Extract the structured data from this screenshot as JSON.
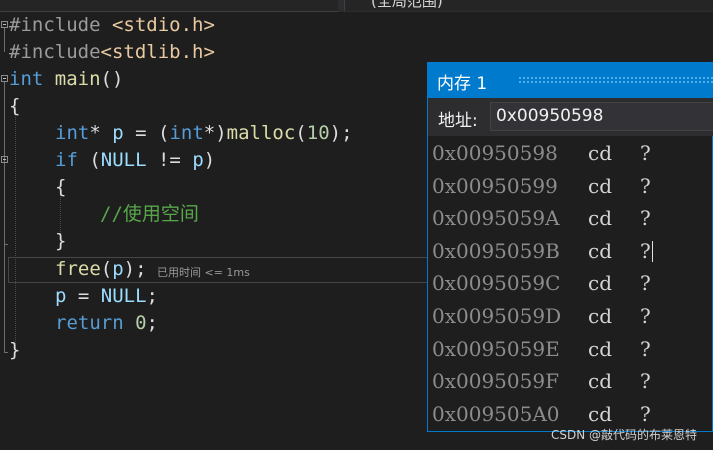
{
  "tab_title": "(全局范围)",
  "code": {
    "l1_pp": "#include",
    "l1_hdr": "<stdio.h>",
    "l2_pp": "#include",
    "l2_hdr": "<stdlib.h>",
    "l3_kw": "int",
    "l3_fn": "main",
    "l3_rest": "()",
    "l4": "{",
    "l5_kw1": "int",
    "l5_p1": "* ",
    "l5_var": "p",
    "l5_p2": " = (",
    "l5_kw2": "int",
    "l5_p3": "*)",
    "l5_fn": "malloc",
    "l5_p4": "(",
    "l5_num": "10",
    "l5_p5": ");",
    "l6_kw": "if",
    "l6_p1": " (",
    "l6_null": "NULL",
    "l6_p2": " != ",
    "l6_var": "p",
    "l6_p3": ")",
    "l7": "{",
    "l8_cmt": "//使用空间",
    "l9": "}",
    "l10_fn": "free",
    "l10_p1": "(",
    "l10_var": "p",
    "l10_p2": ");",
    "l11_var": "p",
    "l11_p1": " = ",
    "l11_null": "NULL",
    "l11_p2": ";",
    "l12_kw": "return",
    "l12_sp": " ",
    "l12_num": "0",
    "l12_p": ";",
    "l13": "}"
  },
  "perf_tip": "已用时间 <= 1ms",
  "memory": {
    "title": "内存 1",
    "address_label": "地址:",
    "address_value": "0x00950598",
    "rows": [
      {
        "addr": "0x00950598",
        "hex": "cd",
        "chr": "?"
      },
      {
        "addr": "0x00950599",
        "hex": "cd",
        "chr": "?"
      },
      {
        "addr": "0x0095059A",
        "hex": "cd",
        "chr": "?"
      },
      {
        "addr": "0x0095059B",
        "hex": "cd",
        "chr": "?"
      },
      {
        "addr": "0x0095059C",
        "hex": "cd",
        "chr": "?"
      },
      {
        "addr": "0x0095059D",
        "hex": "cd",
        "chr": "?"
      },
      {
        "addr": "0x0095059E",
        "hex": "cd",
        "chr": "?"
      },
      {
        "addr": "0x0095059F",
        "hex": "cd",
        "chr": "?"
      },
      {
        "addr": "0x009505A0",
        "hex": "cd",
        "chr": "?"
      }
    ]
  },
  "watermark": "CSDN @敲代码的布莱恩特",
  "colors": {
    "keyword": "#569cd6",
    "function": "#dcdcaa",
    "variable": "#9cdcfe",
    "number": "#b5cea8",
    "comment": "#57a64a",
    "include_header": "#e8c9a0",
    "accent": "#007acc"
  }
}
